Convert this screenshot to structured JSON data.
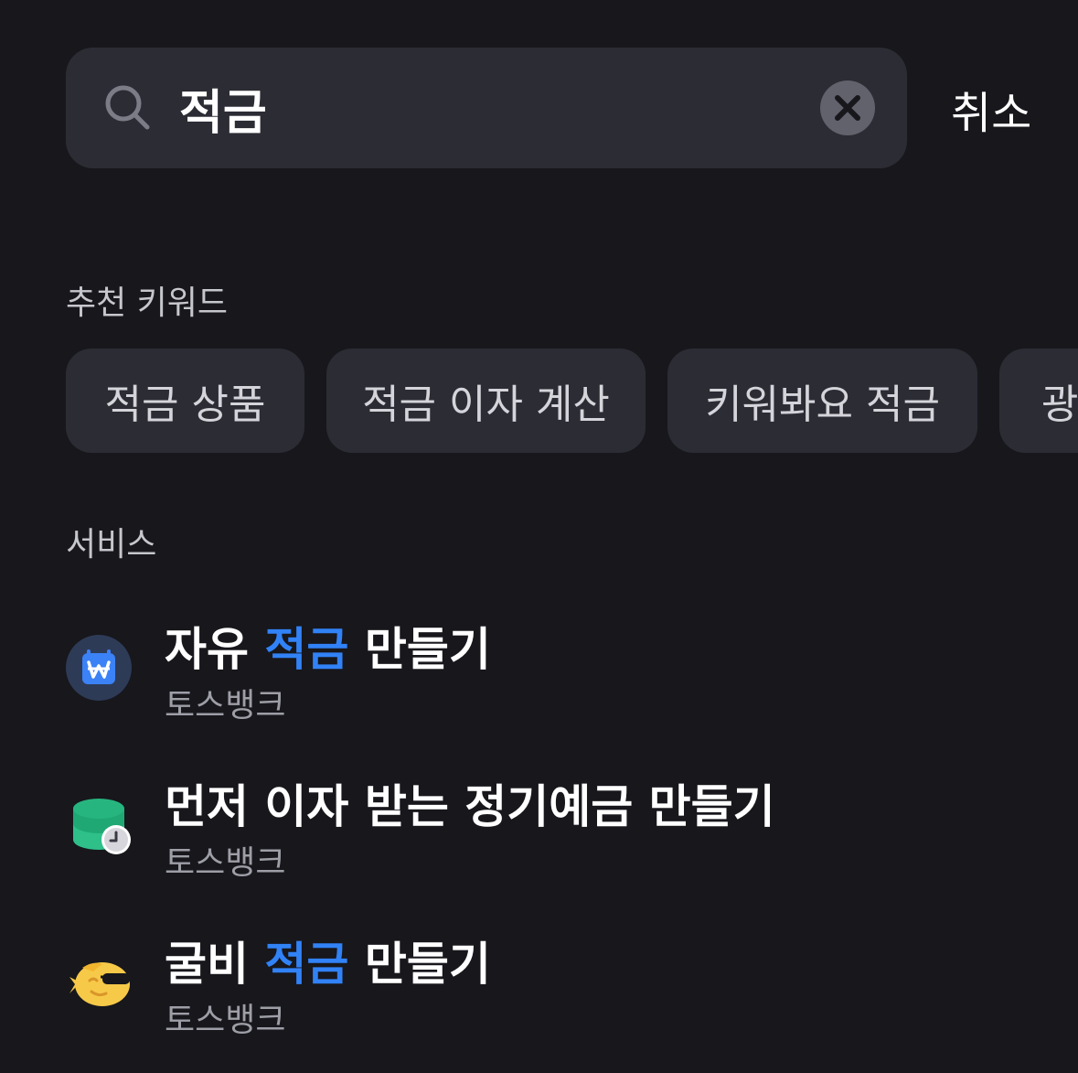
{
  "search": {
    "query": "적금",
    "cancel_label": "취소",
    "icon": "search-icon",
    "clear_icon": "close-icon"
  },
  "keywords": {
    "title": "추천 키워드",
    "items": [
      "적금 상품",
      "적금 이자 계산",
      "키워봐요 적금",
      "광"
    ]
  },
  "services": {
    "title": "서비스",
    "items": [
      {
        "pre": "자유 ",
        "highlight": "적금",
        "post": " 만들기",
        "subtitle": "토스뱅크",
        "icon": "won-calendar-icon"
      },
      {
        "pre": "먼저 이자 받는 정기예금 만들기",
        "highlight": "",
        "post": "",
        "subtitle": "토스뱅크",
        "icon": "coin-stack-clock-icon"
      },
      {
        "pre": "굴비 ",
        "highlight": "적금",
        "post": " 만들기",
        "subtitle": "토스뱅크",
        "icon": "fish-sunglasses-icon"
      }
    ]
  },
  "colors": {
    "background": "#17171c",
    "surface": "#2c2c35",
    "highlight": "#3182f6",
    "subtext": "#9e9ea7"
  }
}
